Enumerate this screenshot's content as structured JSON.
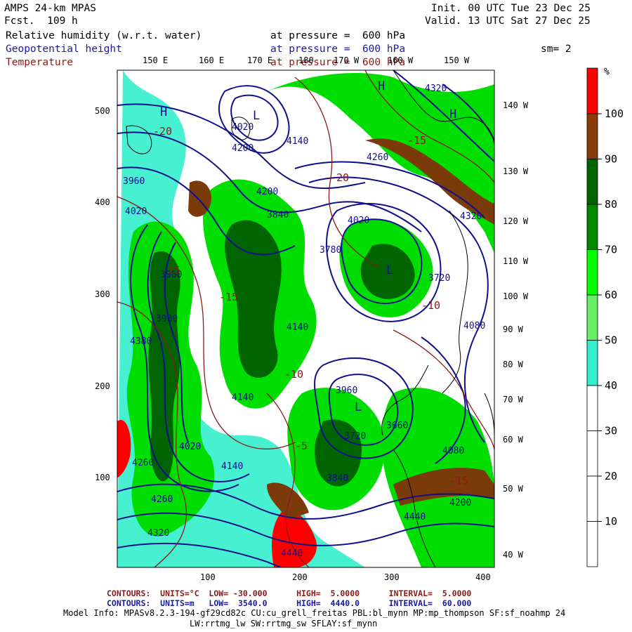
{
  "header": {
    "model_title": "AMPS 24-km MPAS",
    "fcst_label": "Fcst.",
    "fcst_value": "109 h",
    "init_label": "Init.",
    "init_value": "00 UTC Tue 23 Dec 25",
    "valid_label": "Valid.",
    "valid_value": "13 UTC Sat 27 Dec 25",
    "smoothing": "sm= 2"
  },
  "fields": [
    {
      "name": "Relative humidity (w.r.t. water)",
      "level": "at pressure =  600 hPa",
      "color": "#000000"
    },
    {
      "name": "Geopotential height",
      "level": "at pressure =  600 hPa",
      "color": "#1a1aa0"
    },
    {
      "name": "Temperature",
      "level": "at pressure =  600 hPa",
      "color": "#8b1a1a"
    }
  ],
  "map": {
    "top_longitudes": [
      "150 E",
      "160 E",
      "170 E",
      "180",
      "170 W",
      "160 W",
      "150 W"
    ],
    "right_longitudes": [
      "140 W",
      "130 W",
      "120 W",
      "110 W",
      "100 W",
      "90 W",
      "80 W",
      "70 W",
      "60 W",
      "50 W",
      "40 W"
    ],
    "left_axis": [
      "500",
      "400",
      "300",
      "200",
      "100"
    ],
    "bottom_axis": [
      "100",
      "200",
      "300",
      "400"
    ],
    "height_labels": [
      "4020",
      "4200",
      "4140",
      "3960",
      "3960",
      "4020",
      "3840",
      "3780",
      "4200",
      "4020",
      "3900",
      "4380",
      "4320",
      "4260",
      "4140",
      "3720",
      "4080",
      "4140",
      "4020",
      "3960",
      "3720",
      "3840",
      "3660",
      "4260",
      "4320",
      "4440",
      "4440",
      "4200",
      "4080",
      "4140",
      "4260",
      "4320"
    ],
    "temperature_labels": [
      "-20",
      "-15",
      "-25",
      "-10",
      "-15",
      "-20",
      "-10",
      "-15",
      "-5"
    ],
    "pressure_markers": [
      "H",
      "L",
      "H",
      "L",
      "H",
      "L"
    ],
    "colors": {
      "rh_100": "#ff0000",
      "rh_90": "#7a3a0a",
      "rh_80": "#006400",
      "rh_70": "#008800",
      "rh_60": "#00dd00",
      "rh_50": "#66ee66",
      "rh_40": "#11eecc",
      "height_contour": "#10108a",
      "temperature_contour": "#8b1a1a",
      "land": "#000000"
    }
  },
  "colorbar": {
    "unit": "%",
    "ticks": [
      "100",
      "90",
      "80",
      "70",
      "60",
      "50",
      "40",
      "30",
      "20",
      "10"
    ],
    "levels": [
      {
        "color": "#ff0000"
      },
      {
        "color": "#8b3a0a"
      },
      {
        "color": "#006400"
      },
      {
        "color": "#008800"
      },
      {
        "color": "#00ff00"
      },
      {
        "color": "#66ee66"
      },
      {
        "color": "#33eecc"
      },
      {
        "color": "#ffffff"
      },
      {
        "color": "#ffffff"
      },
      {
        "color": "#ffffff"
      },
      {
        "color": "#ffffff"
      }
    ]
  },
  "footer": {
    "temp_contours": {
      "label": "CONTOURS:",
      "units": "UNITS=°C",
      "low": "LOW= -30.000",
      "high": "HIGH=  5.0000",
      "interval": "INTERVAL=  5.0000"
    },
    "height_contours": {
      "label": "CONTOURS:",
      "units": "UNITS=m",
      "low": "LOW=  3540.0",
      "high": "HIGH=  4440.0",
      "interval": "INTERVAL=  60.000"
    },
    "model_info_line1": "Model Info: MPASv8.2.3-194-gf29cd82c CU:cu_grell_freitas PBL:bl_mynn MP:mp_thompson SF:sf_noahmp 24",
    "model_info_line2": "LW:rrtmg_lw SW:rrtmg_sw SFLAY:sf_mynn"
  }
}
